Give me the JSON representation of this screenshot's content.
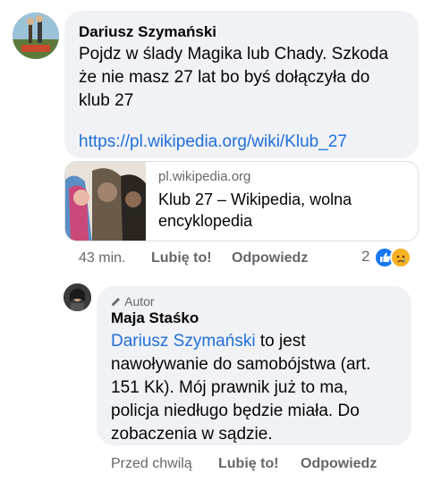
{
  "comment1": {
    "author": "Dariusz Szymański",
    "text_lines": [
      "Pojdz w ślady Magika lub Chady. Szkoda",
      "że nie masz 27 lat bo byś dołączyła do",
      "klub 27"
    ],
    "link_text": "https://pl.wikipedia.org/wiki/Klub_27",
    "preview": {
      "domain": "pl.wikipedia.org",
      "title": "Klub 27 – Wikipedia, wolna encyklopedia"
    },
    "time": "43 min.",
    "like_label": "Lubię to!",
    "reply_label": "Odpowiedz",
    "reaction_count": "2"
  },
  "comment2": {
    "badge": "Autor",
    "author": "Maja Staśko",
    "mention": "Dariusz Szymański",
    "text_after_mention": " to jest",
    "text_lines": [
      "nawoływanie do samobójstwa (art.",
      "151 Kk). Mój prawnik już to ma,",
      "policja niedługo będzie miała. Do",
      "zobaczenia w sądzie."
    ],
    "time": "Przed chwilą",
    "like_label": "Lubię to!",
    "reply_label": "Odpowiedz"
  },
  "colors": {
    "link": "#216fdb",
    "bubble": "#f0f2f5",
    "meta": "#65676b",
    "like": "#1877f2",
    "sad": "#f7b125"
  }
}
